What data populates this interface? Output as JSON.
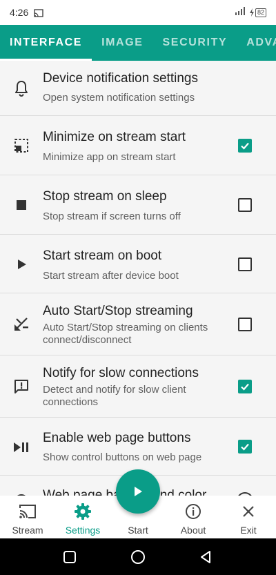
{
  "status_bar": {
    "time": "4:26",
    "battery": "82"
  },
  "tabs": [
    {
      "label": "INTERFACE",
      "active": true
    },
    {
      "label": "IMAGE",
      "active": false
    },
    {
      "label": "SECURITY",
      "active": false
    },
    {
      "label": "ADVANC",
      "active": false
    }
  ],
  "settings": [
    {
      "icon": "bell-icon",
      "title": "Device notification settings",
      "subtitle": "Open system notification settings"
    },
    {
      "icon": "minimize-icon",
      "title": "Minimize on stream start",
      "subtitle": "Minimize app on stream start",
      "checked": true
    },
    {
      "icon": "stop-icon",
      "title": "Stop stream on sleep",
      "subtitle": "Stop stream if screen turns off",
      "checked": false
    },
    {
      "icon": "play-icon",
      "title": "Start stream on boot",
      "subtitle": "Start stream after device boot",
      "checked": false
    },
    {
      "icon": "percent-icon",
      "title": "Auto Start/Stop streaming",
      "subtitle": "Auto Start/Stop streaming on clients connect/disconnect",
      "checked": false
    },
    {
      "icon": "alert-message-icon",
      "title": "Notify for slow connections",
      "subtitle": "Detect and notify for slow client connections",
      "checked": true
    },
    {
      "icon": "play-pause-icon",
      "title": "Enable web page buttons",
      "subtitle": "Show control buttons on web page",
      "checked": true
    },
    {
      "icon": "palette-icon",
      "title": "Web page background color"
    }
  ],
  "bottom_nav": [
    {
      "icon": "cast-icon",
      "label": "Stream",
      "active": false
    },
    {
      "icon": "gear-icon",
      "label": "Settings",
      "active": true
    },
    {
      "icon": "play-icon",
      "label": "Start",
      "active": false
    },
    {
      "icon": "info-icon",
      "label": "About",
      "active": false
    },
    {
      "icon": "close-icon",
      "label": "Exit",
      "active": false
    }
  ],
  "colors": {
    "accent": "#0a9d88",
    "system_nav": "#000000"
  }
}
